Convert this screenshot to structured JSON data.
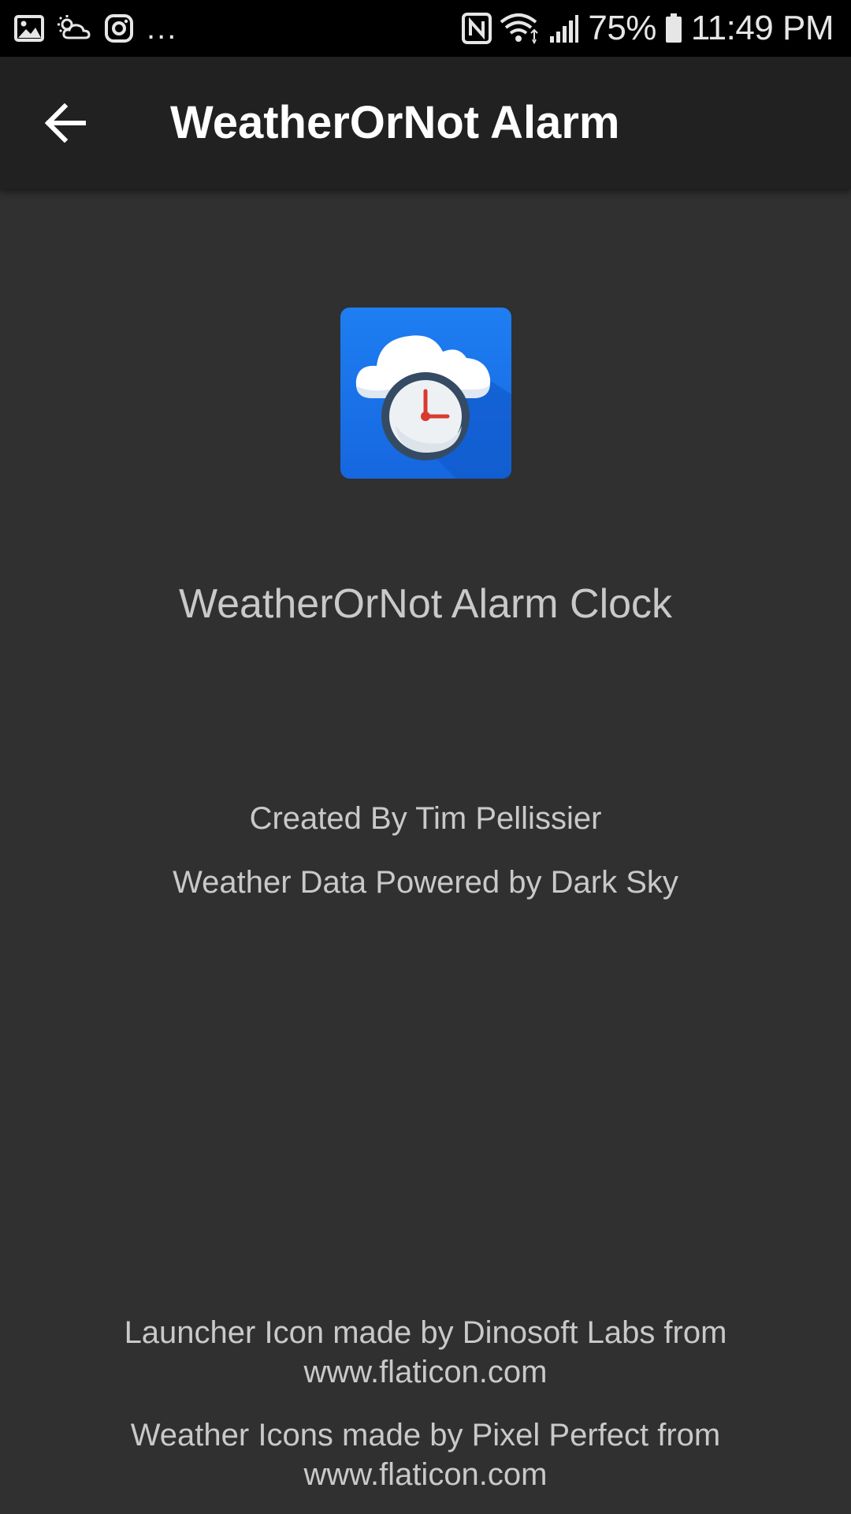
{
  "status_bar": {
    "left_icons": [
      "gallery-icon",
      "weather-icon",
      "instagram-icon"
    ],
    "more_indicator": "...",
    "right_icons": [
      "nfc-icon",
      "wifi-icon",
      "signal-icon",
      "battery-icon"
    ],
    "battery": "75%",
    "time": "11:49 PM"
  },
  "toolbar": {
    "back_icon": "arrow-back-icon",
    "title": "WeatherOrNot Alarm"
  },
  "app": {
    "icon": "cloud-clock-icon",
    "name": "WeatherOrNot Alarm Clock"
  },
  "credits": {
    "created_by": "Created By Tim Pellissier",
    "weather_data": "Weather Data Powered by Dark Sky"
  },
  "footer": {
    "launcher_line1": "Launcher Icon made by Dinosoft Labs from",
    "launcher_line2": "www.flaticon.com",
    "weather_icons_line1": "Weather Icons made by Pixel Perfect from",
    "weather_icons_line2": "www.flaticon.com"
  },
  "colors": {
    "background": "#303030",
    "toolbar": "#212121",
    "status_bar": "#000000",
    "icon_blue": "#1a73e8",
    "text": "#c9c9c9"
  }
}
